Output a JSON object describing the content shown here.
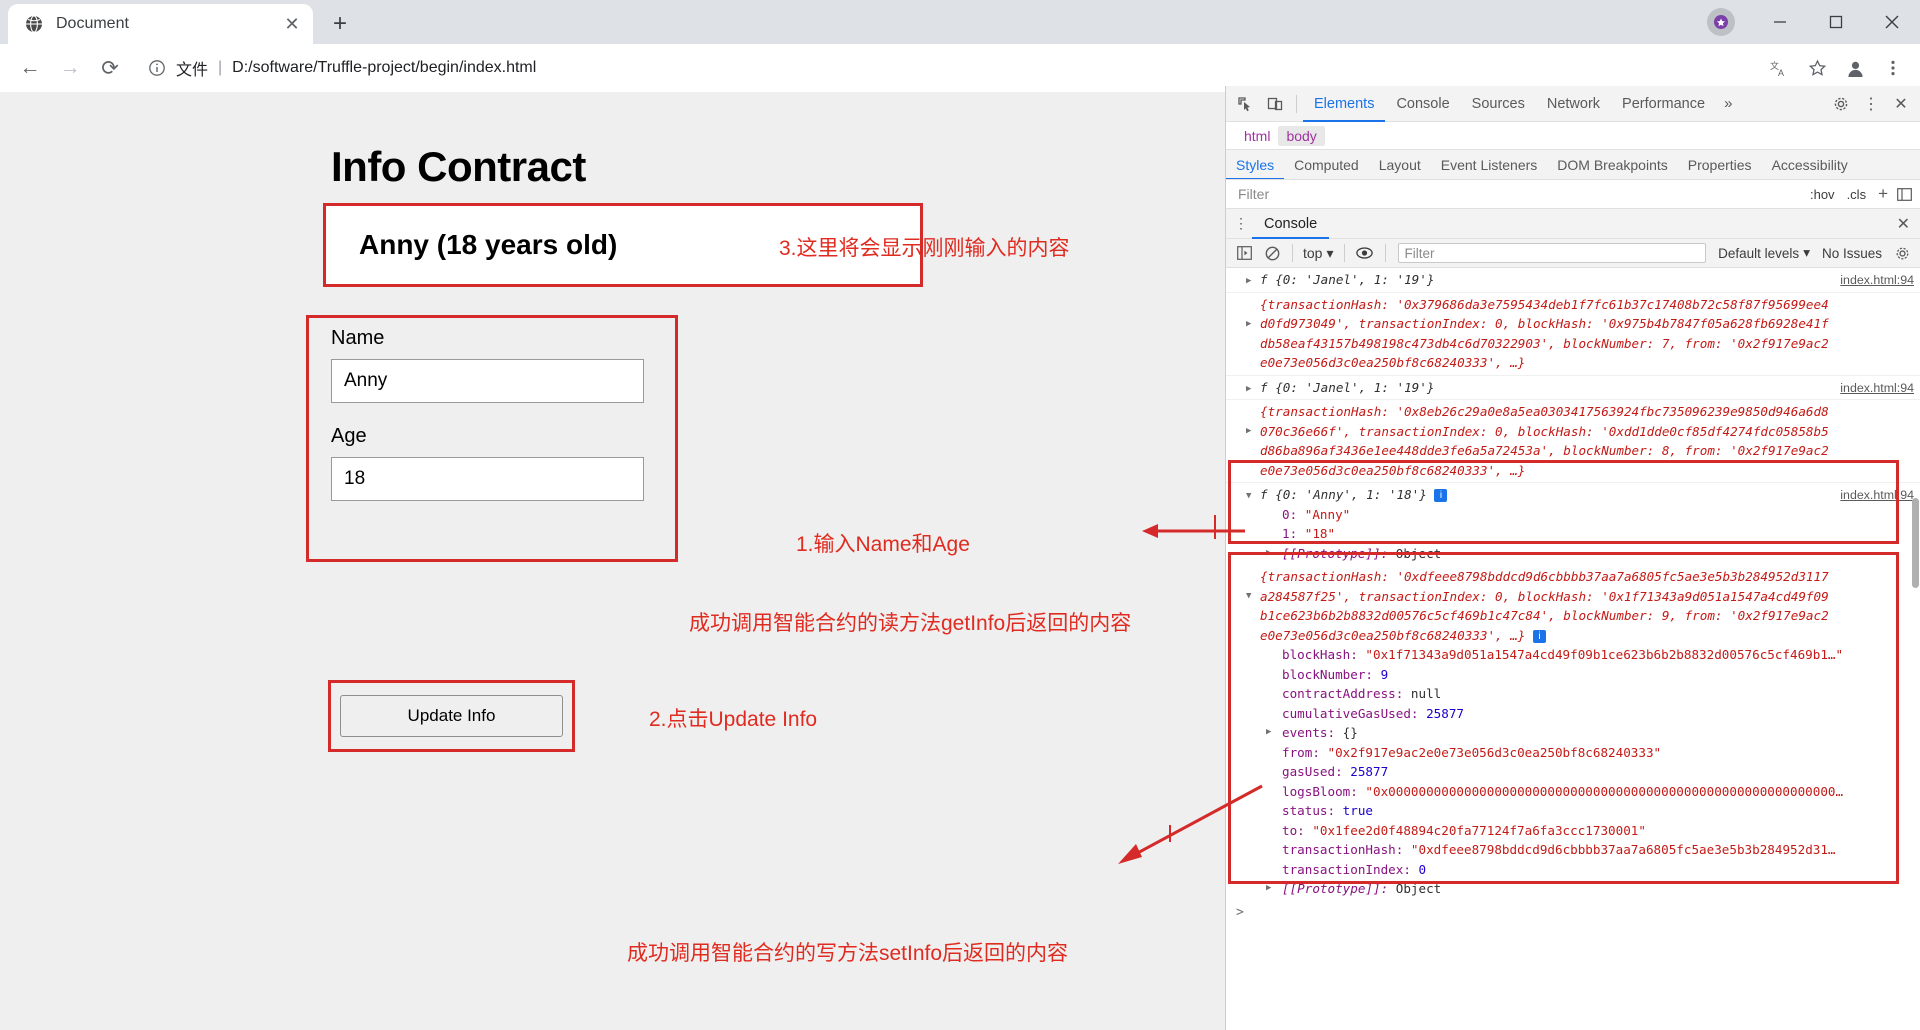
{
  "browser": {
    "tab": {
      "title": "Document",
      "favicon": "globe-icon",
      "close": "✕"
    },
    "newtab_label": "+",
    "window_controls": {
      "minimize": "—",
      "maximize": "▢",
      "close": "✕"
    },
    "nav": {
      "back": "←",
      "forward": "→",
      "reload": "⟳"
    },
    "omnibox": {
      "info_icon": "info-circle-icon",
      "scheme_label": "文件",
      "separator": "|",
      "url": "D:/software/Truffle-project/begin/index.html"
    },
    "toolbar_icons": [
      "translate-icon",
      "bookmark-star-icon",
      "profile-avatar-icon",
      "more-menu-icon"
    ]
  },
  "page": {
    "title": "Info Contract",
    "display_value": "Anny (18 years old)",
    "fields": [
      {
        "label": "Name",
        "value": "Anny"
      },
      {
        "label": "Age",
        "value": "18"
      }
    ],
    "button_label": "Update Info",
    "annotations": [
      {
        "text": "3.这里将会显示刚刚输入的内容"
      },
      {
        "text": "1.输入Name和Age"
      },
      {
        "text": "2.点击Update Info"
      },
      {
        "text": "成功调用智能合约的读方法getInfo后返回的内容"
      },
      {
        "text": "成功调用智能合约的写方法setInfo后返回的内容"
      }
    ],
    "annotation_color": "#e02b20"
  },
  "devtools": {
    "toolbar_icons": [
      "inspect-element-icon",
      "device-toolbar-icon"
    ],
    "panels": [
      "Elements",
      "Console",
      "Sources",
      "Network",
      "Performance"
    ],
    "active_panel": "Elements",
    "more_panels": "»",
    "settings_icon": "gear-icon",
    "kebab_icon": "⋮",
    "close_icon": "✕",
    "breadcrumb": [
      "html",
      "body"
    ],
    "sidebar_tabs": [
      "Styles",
      "Computed",
      "Layout",
      "Event Listeners",
      "DOM Breakpoints",
      "Properties",
      "Accessibility"
    ],
    "active_sidebar_tab": "Styles",
    "filter_placeholder": "Filter",
    "hov_label": ":hov",
    "cls_label": ".cls",
    "plus_label": "+",
    "drawer_tab": "Console",
    "console_toolbar": {
      "sidebar_icon": "console-sidebar-icon",
      "clear_icon": "clear-console-icon",
      "context": "top",
      "context_caret": "▾",
      "eye_icon": "live-expression-icon",
      "filter_placeholder": "Filter",
      "levels": "Default levels",
      "levels_caret": "▾",
      "issues": "No Issues",
      "settings_icon": "gear-icon"
    },
    "source_link": "index.html:94",
    "prompt": ">",
    "messages": [
      {
        "id": "m1",
        "collapsed": true,
        "head_prefix": "f",
        "head": "{0: 'Janel', 1: '19'}",
        "key0": "0:",
        "val0": "'Janel'",
        "key1": "1:",
        "val1": "'19'",
        "source": "index.html:94"
      },
      {
        "id": "m2",
        "collapsed": true,
        "lines": [
          "{transactionHash: '0x379686da3e7595434deb1f7fc61b37c17408b72c58f87f95699ee4",
          "d0fd973049', transactionIndex: 0, blockHash: '0x975b4b7847f05a628fb6928e41f",
          "db58eaf43157b498198c473db4c6d70322903', blockNumber: 7, from: '0x2f917e9ac2",
          "e0e73e056d3c0ea250bf8c68240333', …}"
        ]
      },
      {
        "id": "m3",
        "collapsed": true,
        "head_prefix": "f",
        "head": "{0: 'Janel', 1: '19'}",
        "source": "index.html:94"
      },
      {
        "id": "m4",
        "collapsed": true,
        "lines": [
          "{transactionHash: '0x8eb26c29a0e8a5ea0303417563924fbc735096239e9850d946a6d8",
          "070c36e66f', transactionIndex: 0, blockHash: '0xdd1dde0cf85df4274fdc05858b5",
          "d86ba896af3436e1ee448dde3fe6a5a72453a', blockNumber: 8, from: '0x2f917e9ac2",
          "e0e73e056d3c0ea250bf8c68240333', …}"
        ]
      },
      {
        "id": "m5",
        "expanded": true,
        "head_prefix": "f",
        "head": "{0: 'Anny', 1: '18'}",
        "badge": "i",
        "source": "index.html:94",
        "props": [
          {
            "key": "0:",
            "value": "\"Anny\""
          },
          {
            "key": "1:",
            "value": "\"18\""
          },
          {
            "key": "[[Prototype]]:",
            "value": "Object",
            "proto": true
          }
        ]
      },
      {
        "id": "m6",
        "expanded": true,
        "lines": [
          "{transactionHash: '0xdfeee8798bddcd9d6cbbbb37aa7a6805fc5ae3e5b3b284952d3117",
          "a284587f25', transactionIndex: 0, blockHash: '0x1f71343a9d051a1547a4cd49f09",
          "b1ce623b6b2b8832d00576c5cf469b1c47c84', blockNumber: 9, from: '0x2f917e9ac2",
          "e0e73e056d3c0ea250bf8c68240333', …}"
        ],
        "badge": "i",
        "props": [
          {
            "key": "blockHash:",
            "value": "\"0x1f71343a9d051a1547a4cd49f09b1ce623b6b2b8832d00576c5cf469b1…\"",
            "str": true
          },
          {
            "key": "blockNumber:",
            "value": "9",
            "num": true
          },
          {
            "key": "contractAddress:",
            "value": "null",
            "grey": true
          },
          {
            "key": "cumulativeGasUsed:",
            "value": "25877",
            "num": true
          },
          {
            "key": "events:",
            "value": "{}",
            "grey": true,
            "arrow": true
          },
          {
            "key": "from:",
            "value": "\"0x2f917e9ac2e0e73e056d3c0ea250bf8c68240333\"",
            "str": true
          },
          {
            "key": "gasUsed:",
            "value": "25877",
            "num": true
          },
          {
            "key": "logsBloom:",
            "value": "\"0x00000000000000000000000000000000000000000000000000000000000000…",
            "str": true
          },
          {
            "key": "status:",
            "value": "true",
            "num": true
          },
          {
            "key": "to:",
            "value": "\"0x1fee2d0f48894c20fa77124f7a6fa3ccc1730001\"",
            "str": true
          },
          {
            "key": "transactionHash:",
            "value": "\"0xdfeee8798bddcd9d6cbbbb37aa7a6805fc5ae3e5b3b284952d31…",
            "str": true
          },
          {
            "key": "transactionIndex:",
            "value": "0",
            "num": true
          },
          {
            "key": "[[Prototype]]:",
            "value": "Object",
            "proto": true,
            "arrow": true
          }
        ]
      }
    ]
  }
}
